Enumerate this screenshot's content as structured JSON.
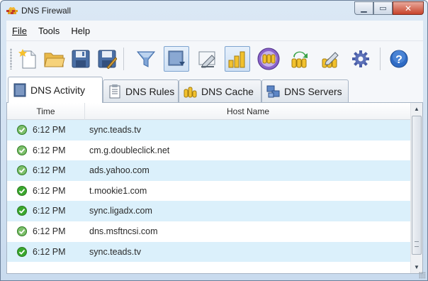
{
  "window": {
    "title": "DNS Firewall"
  },
  "menu": [
    {
      "label": "File"
    },
    {
      "label": "Tools"
    },
    {
      "label": "Help"
    }
  ],
  "toolbar": {
    "buttons": [
      {
        "icon": "new-file-icon",
        "pressed": false
      },
      {
        "icon": "open-folder-icon",
        "pressed": false
      },
      {
        "icon": "save-icon",
        "pressed": false
      },
      {
        "icon": "save-as-icon",
        "pressed": false
      },
      {
        "icon": "filter-icon",
        "pressed": false
      },
      {
        "icon": "autoscroll-icon",
        "pressed": true
      },
      {
        "icon": "clear-icon",
        "pressed": false
      },
      {
        "icon": "statistics-icon",
        "pressed": true
      },
      {
        "icon": "cache-coins-icon",
        "pressed": false
      },
      {
        "icon": "refresh-cache-icon",
        "pressed": false
      },
      {
        "icon": "clear-cache-icon",
        "pressed": false
      },
      {
        "icon": "settings-gear-icon",
        "pressed": false
      },
      {
        "icon": "help-icon",
        "pressed": false
      }
    ]
  },
  "tabs": [
    {
      "label": "DNS Activity",
      "active": true
    },
    {
      "label": "DNS Rules",
      "active": false
    },
    {
      "label": "DNS Cache",
      "active": false
    },
    {
      "label": "DNS Servers",
      "active": false
    }
  ],
  "table": {
    "columns": [
      "Time",
      "Host Name"
    ],
    "rows": [
      {
        "time": "6:12 PM",
        "host": "sync.teads.tv",
        "status": "cached"
      },
      {
        "time": "6:12 PM",
        "host": "cm.g.doubleclick.net",
        "status": "cached"
      },
      {
        "time": "6:12 PM",
        "host": "ads.yahoo.com",
        "status": "cached"
      },
      {
        "time": "6:12 PM",
        "host": "t.mookie1.com",
        "status": "allowed"
      },
      {
        "time": "6:12 PM",
        "host": "sync.ligadx.com",
        "status": "allowed"
      },
      {
        "time": "6:12 PM",
        "host": "dns.msftncsi.com",
        "status": "cached"
      },
      {
        "time": "6:12 PM",
        "host": "sync.teads.tv",
        "status": "allowed"
      }
    ]
  },
  "colors": {
    "row_alt": "#dbf0fb",
    "status_green": "#3aa82d",
    "status_cached": "#7cbf6a"
  }
}
